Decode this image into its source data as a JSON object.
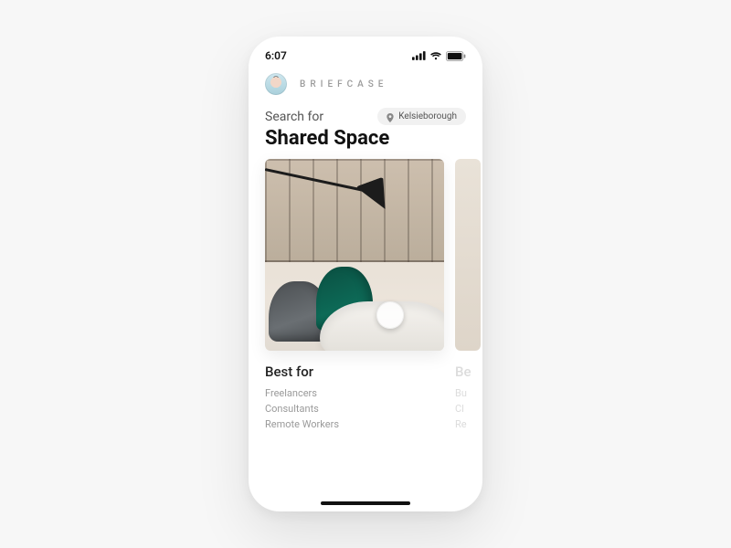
{
  "status": {
    "time": "6:07"
  },
  "header": {
    "brand": "BRIEFCASE"
  },
  "search": {
    "label": "Search for",
    "location": "Kelsieborough"
  },
  "title": "Shared Space",
  "cards": [
    {
      "best_for_heading": "Best for",
      "best_for": [
        "Freelancers",
        "Consultants",
        "Remote Workers"
      ]
    },
    {
      "best_for_heading": "Be",
      "best_for": [
        "Bu",
        "Cl",
        "Re"
      ]
    }
  ]
}
